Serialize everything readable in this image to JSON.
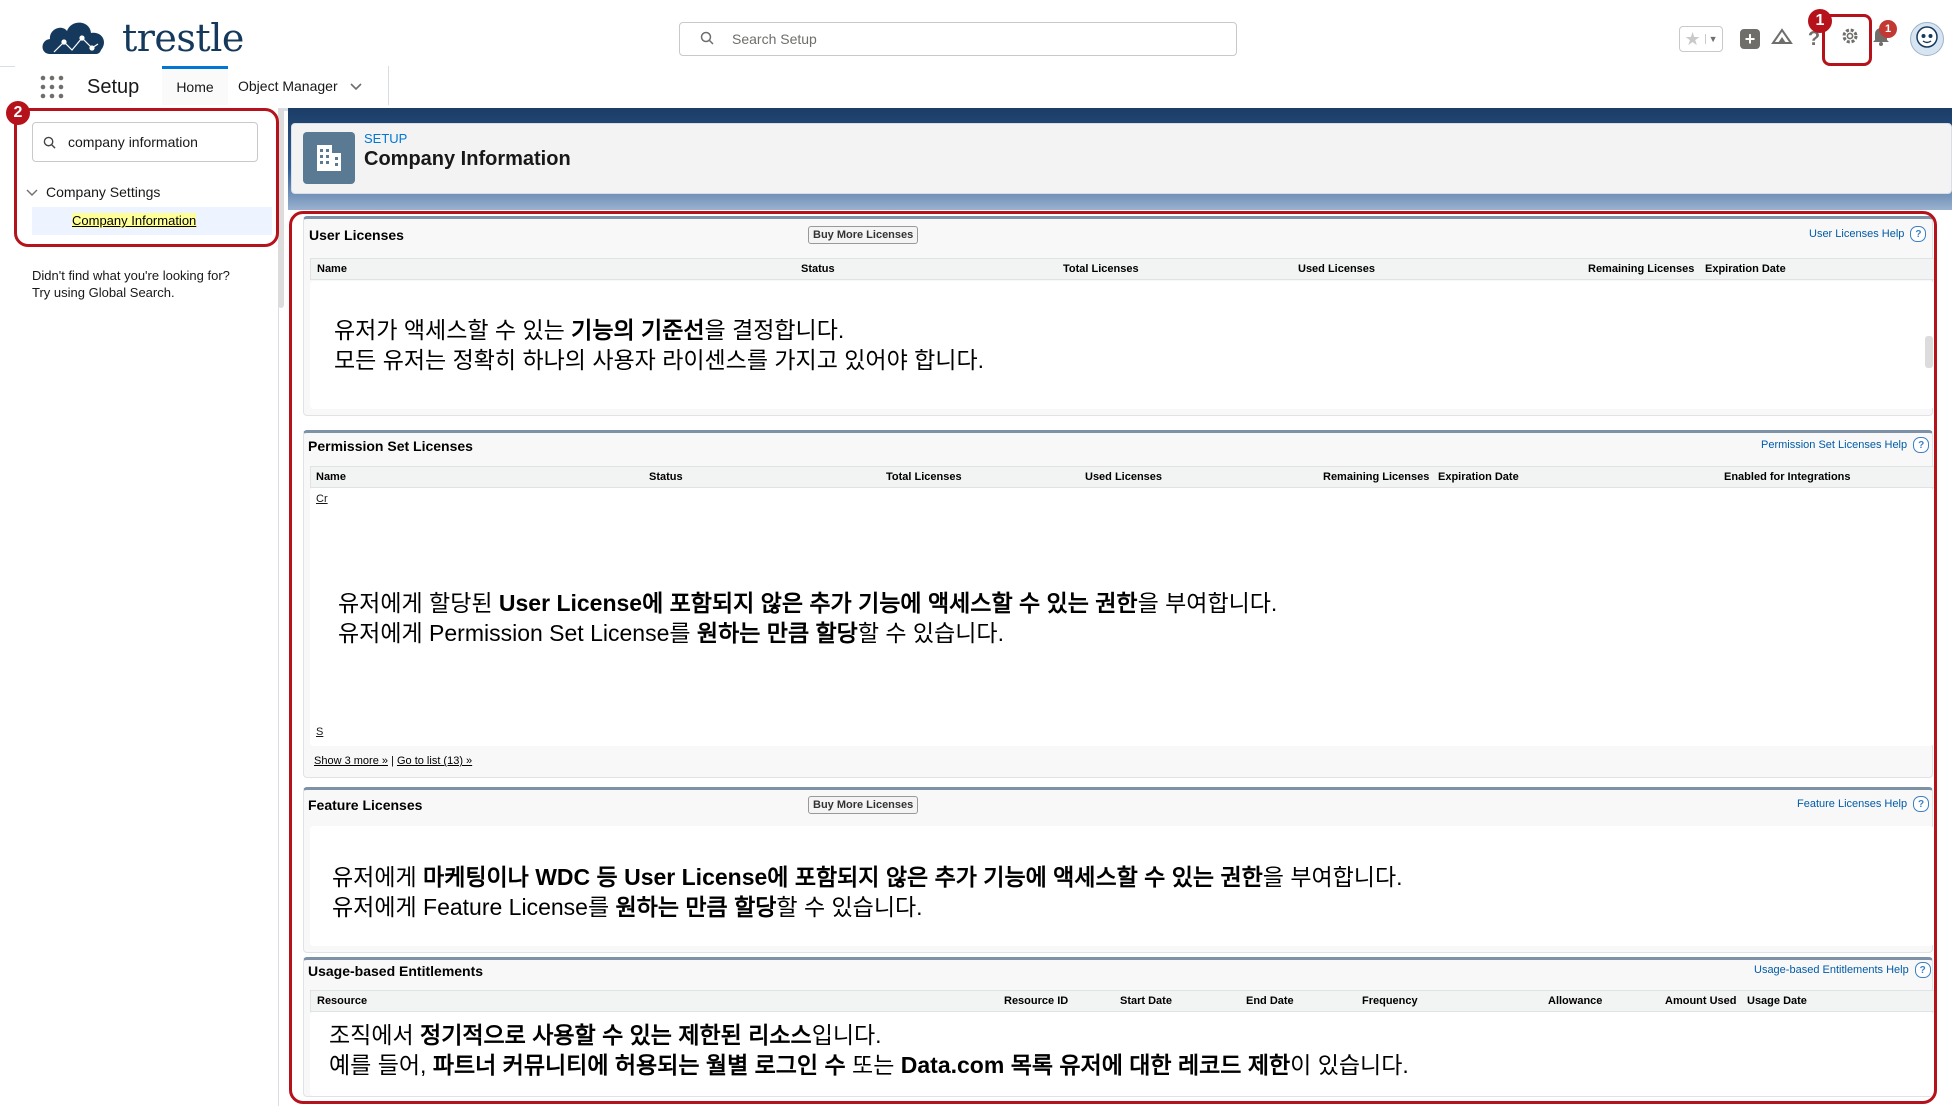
{
  "header": {
    "logo_text": "trestle",
    "search_placeholder": "Search Setup",
    "notification_count": "1"
  },
  "markers": {
    "first": "1",
    "second": "2"
  },
  "nav": {
    "app_name": "Setup",
    "tabs": [
      {
        "label": "Home"
      },
      {
        "label": "Object Manager"
      }
    ]
  },
  "sidebar": {
    "quickfind_value": "company information",
    "group_label": "Company Settings",
    "item_label": "Company Information",
    "not_found_line1": "Didn't find what you're looking for?",
    "not_found_line2": "Try using Global Search."
  },
  "page_header": {
    "eyebrow": "SETUP",
    "title": "Company Information"
  },
  "user_licenses": {
    "title": "User Licenses",
    "button": "Buy More Licenses",
    "help": "User Licenses Help",
    "columns": [
      "Name",
      "Status",
      "Total Licenses",
      "Used Licenses",
      "Remaining Licenses",
      "Expiration Date"
    ],
    "note_line1_a": "유저가 액세스할 수 있는 ",
    "note_line1_b": "기능의 기준선",
    "note_line1_c": "을 결정합니다.",
    "note_line2": "모든 유저는 정확히 하나의 사용자 라이센스를 가지고 있어야 합니다."
  },
  "permission_set_licenses": {
    "title": "Permission Set Licenses",
    "help": "Permission Set Licenses Help",
    "columns": [
      "Name",
      "Status",
      "Total Licenses",
      "Used Licenses",
      "Remaining Licenses",
      "Expiration Date",
      "Enabled for Integrations"
    ],
    "first_cell_fragment": "Cr",
    "last_cell_fragment": "S",
    "note_line1_a": "유저에게 할당된 ",
    "note_line1_b": "User License에 포함되지 않은 추가 기능에 액세스할 수 있는 권한",
    "note_line1_c": "을 부여합니다.",
    "note_line2_a": "유저에게 Permission Set License를 ",
    "note_line2_b": "원하는 만큼 할당",
    "note_line2_c": "할 수 있습니다.",
    "show_more": "Show 3 more »",
    "separator": "|",
    "go_to_list": "Go to list (13) »"
  },
  "feature_licenses": {
    "title": "Feature Licenses",
    "button": "Buy More Licenses",
    "help": "Feature Licenses Help",
    "note_line1_a": "유저에게 ",
    "note_line1_b": "마케팅이나 WDC 등 User License에 포함되지 않은 추가 기능에 액세스할 수 있는 권한",
    "note_line1_c": "을 부여합니다.",
    "note_line2_a": "유저에게 Feature License를 ",
    "note_line2_b": "원하는 만큼 할당",
    "note_line2_c": "할 수 있습니다."
  },
  "usage_entitlements": {
    "title": "Usage-based Entitlements",
    "help": "Usage-based Entitlements Help",
    "columns": [
      "Resource",
      "Resource ID",
      "Start Date",
      "End Date",
      "Frequency",
      "Allowance",
      "Amount Used",
      "Usage Date"
    ],
    "note_line1_a": "조직에서 ",
    "note_line1_b": "정기적으로 사용할 수 있는 제한된 리소스",
    "note_line1_c": "입니다.",
    "note_line2_a": "예를 들어, ",
    "note_line2_b": "파트너 커뮤니티에 허용되는 월별 로그인 수",
    "note_line2_c": " 또는 ",
    "note_line2_d": "Data.com 목록 유저에 대한 레코드 제한",
    "note_line2_e": "이 있습니다."
  },
  "colors": {
    "accent_red": "#b5121b",
    "link_blue": "#015ba7",
    "brand_navy": "#15395d"
  },
  "icons": [
    "cloud-logo-icon",
    "search-icon",
    "favorite-star-icon",
    "add-icon",
    "trailhead-icon",
    "help-icon",
    "gear-icon",
    "bell-icon",
    "avatar-icon",
    "app-launcher-icon",
    "chevron-down-icon",
    "building-icon",
    "help-circle-icon"
  ]
}
